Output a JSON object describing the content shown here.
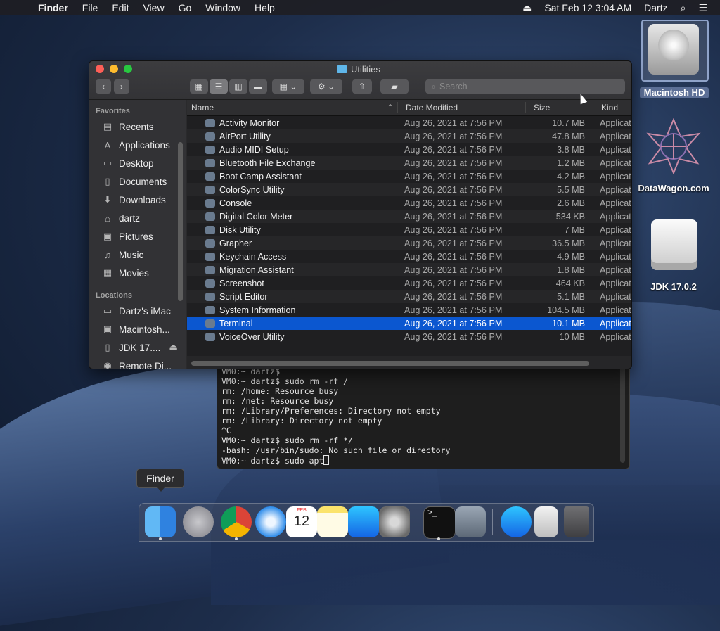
{
  "menubar": {
    "app": "Finder",
    "items": [
      "File",
      "Edit",
      "View",
      "Go",
      "Window",
      "Help"
    ],
    "datetime": "Sat Feb 12  3:04 AM",
    "user": "Dartz"
  },
  "desktop": {
    "icons": [
      "Macintosh HD",
      "DataWagon.com",
      "JDK 17.0.2"
    ]
  },
  "finder": {
    "title": "Utilities",
    "search_placeholder": "Search",
    "sidebar": {
      "favorites_header": "Favorites",
      "favorites": [
        "Recents",
        "Applications",
        "Desktop",
        "Documents",
        "Downloads",
        "dartz",
        "Pictures",
        "Music",
        "Movies"
      ],
      "locations_header": "Locations",
      "locations": [
        "Dartz's iMac",
        "Macintosh...",
        "JDK 17....",
        "Remote Di..."
      ]
    },
    "columns": [
      "Name",
      "Date Modified",
      "Size",
      "Kind"
    ],
    "rows": [
      {
        "name": "Activity Monitor",
        "date": "Aug 26, 2021 at 7:56 PM",
        "size": "10.7 MB",
        "kind": "Applicat"
      },
      {
        "name": "AirPort Utility",
        "date": "Aug 26, 2021 at 7:56 PM",
        "size": "47.8 MB",
        "kind": "Applicat"
      },
      {
        "name": "Audio MIDI Setup",
        "date": "Aug 26, 2021 at 7:56 PM",
        "size": "3.8 MB",
        "kind": "Applicat"
      },
      {
        "name": "Bluetooth File Exchange",
        "date": "Aug 26, 2021 at 7:56 PM",
        "size": "1.2 MB",
        "kind": "Applicat"
      },
      {
        "name": "Boot Camp Assistant",
        "date": "Aug 26, 2021 at 7:56 PM",
        "size": "4.2 MB",
        "kind": "Applicat"
      },
      {
        "name": "ColorSync Utility",
        "date": "Aug 26, 2021 at 7:56 PM",
        "size": "5.5 MB",
        "kind": "Applicat"
      },
      {
        "name": "Console",
        "date": "Aug 26, 2021 at 7:56 PM",
        "size": "2.6 MB",
        "kind": "Applicat"
      },
      {
        "name": "Digital Color Meter",
        "date": "Aug 26, 2021 at 7:56 PM",
        "size": "534 KB",
        "kind": "Applicat"
      },
      {
        "name": "Disk Utility",
        "date": "Aug 26, 2021 at 7:56 PM",
        "size": "7 MB",
        "kind": "Applicat"
      },
      {
        "name": "Grapher",
        "date": "Aug 26, 2021 at 7:56 PM",
        "size": "36.5 MB",
        "kind": "Applicat"
      },
      {
        "name": "Keychain Access",
        "date": "Aug 26, 2021 at 7:56 PM",
        "size": "4.9 MB",
        "kind": "Applicat"
      },
      {
        "name": "Migration Assistant",
        "date": "Aug 26, 2021 at 7:56 PM",
        "size": "1.8 MB",
        "kind": "Applicat"
      },
      {
        "name": "Screenshot",
        "date": "Aug 26, 2021 at 7:56 PM",
        "size": "464 KB",
        "kind": "Applicat"
      },
      {
        "name": "Script Editor",
        "date": "Aug 26, 2021 at 7:56 PM",
        "size": "5.1 MB",
        "kind": "Applicat"
      },
      {
        "name": "System Information",
        "date": "Aug 26, 2021 at 7:56 PM",
        "size": "104.5 MB",
        "kind": "Applicat"
      },
      {
        "name": "Terminal",
        "date": "Aug 26, 2021 at 7:56 PM",
        "size": "10.1 MB",
        "kind": "Applicat",
        "selected": true
      },
      {
        "name": "VoiceOver Utility",
        "date": "Aug 26, 2021 at 7:56 PM",
        "size": "10 MB",
        "kind": "Applicat"
      }
    ]
  },
  "terminal": {
    "lines": [
      "VM0:~ dartz$",
      "VM0:~ dartz$ sudo rm -rf /",
      "rm: /home: Resource busy",
      "rm: /net: Resource busy",
      "rm: /Library/Preferences: Directory not empty",
      "rm: /Library: Directory not empty",
      "^C",
      "VM0:~ dartz$ sudo rm -rf */",
      "-bash: /usr/bin/sudo: No such file or directory",
      "VM0:~ dartz$ sudo apt"
    ]
  },
  "dock": {
    "tooltip": "Finder",
    "calendar_month": "FEB",
    "calendar_day": "12",
    "apps": [
      "finder-icon",
      "launchpad-icon",
      "chrome-icon",
      "safari-icon",
      "calendar-icon",
      "notes-icon",
      "app-store-icon",
      "system-preferences-icon",
      "terminal-icon",
      "accessibility-icon",
      "app-store-downloads-icon",
      "document-icon",
      "trash-icon"
    ]
  },
  "colors": {
    "accent": "#0b57d0",
    "window_bg": "#2a2a2c"
  }
}
